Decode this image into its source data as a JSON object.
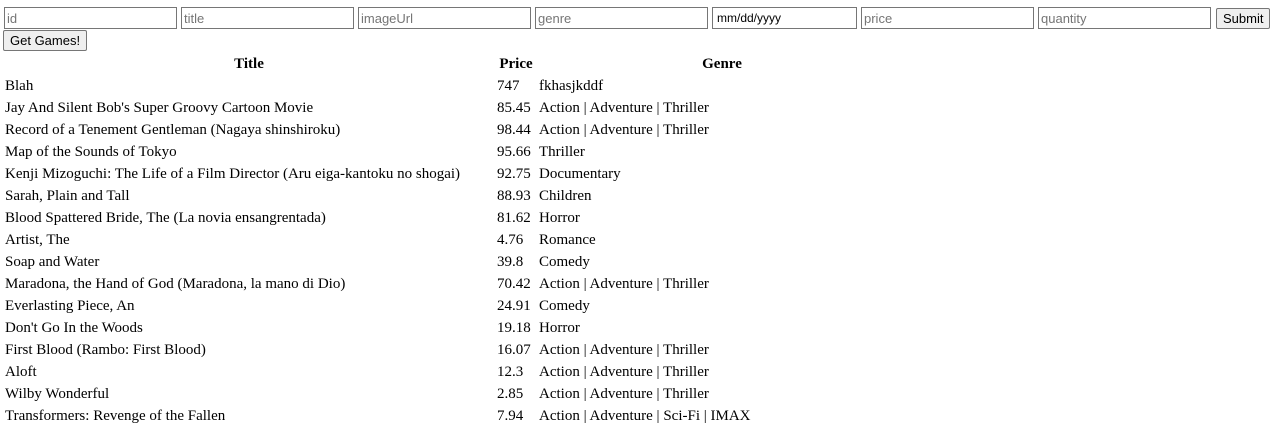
{
  "form": {
    "fields": [
      {
        "name": "id-field",
        "placeholder": "id"
      },
      {
        "name": "title-field",
        "placeholder": "title"
      },
      {
        "name": "image-url-field",
        "placeholder": "imageUrl"
      },
      {
        "name": "genre-field",
        "placeholder": "genre"
      }
    ],
    "date_placeholder": "mm/dd/yyyy",
    "fields_after_date": [
      {
        "name": "price-field",
        "placeholder": "price"
      },
      {
        "name": "quantity-field",
        "placeholder": "quantity"
      }
    ],
    "submit_label": "Submit"
  },
  "get_games_label": "Get Games!",
  "table": {
    "headers": {
      "title": "Title",
      "price": "Price",
      "genre": "Genre"
    },
    "rows": [
      {
        "title": "Blah",
        "price": "747",
        "genre": "fkhasjkddf"
      },
      {
        "title": "Jay And Silent Bob's Super Groovy Cartoon Movie",
        "price": "85.45",
        "genre": "Action | Adventure | Thriller"
      },
      {
        "title": "Record of a Tenement Gentleman (Nagaya shinshiroku)",
        "price": "98.44",
        "genre": "Action | Adventure | Thriller"
      },
      {
        "title": "Map of the Sounds of Tokyo",
        "price": "95.66",
        "genre": "Thriller"
      },
      {
        "title": "Kenji Mizoguchi: The Life of a Film Director (Aru eiga-kantoku no shogai)",
        "price": "92.75",
        "genre": "Documentary"
      },
      {
        "title": "Sarah, Plain and Tall",
        "price": "88.93",
        "genre": "Children"
      },
      {
        "title": "Blood Spattered Bride, The (La novia ensangrentada)",
        "price": "81.62",
        "genre": "Horror"
      },
      {
        "title": "Artist, The",
        "price": "4.76",
        "genre": "Romance"
      },
      {
        "title": "Soap and Water",
        "price": "39.8",
        "genre": "Comedy"
      },
      {
        "title": "Maradona, the Hand of God (Maradona, la mano di Dio)",
        "price": "70.42",
        "genre": "Action | Adventure | Thriller"
      },
      {
        "title": "Everlasting Piece, An",
        "price": "24.91",
        "genre": "Comedy"
      },
      {
        "title": "Don't Go In the Woods",
        "price": "19.18",
        "genre": "Horror"
      },
      {
        "title": "First Blood (Rambo: First Blood)",
        "price": "16.07",
        "genre": "Action | Adventure | Thriller"
      },
      {
        "title": "Aloft",
        "price": "12.3",
        "genre": "Action | Adventure | Thriller"
      },
      {
        "title": "Wilby Wonderful",
        "price": "2.85",
        "genre": "Action | Adventure | Thriller"
      },
      {
        "title": "Transformers: Revenge of the Fallen",
        "price": "7.94",
        "genre": "Action | Adventure | Sci-Fi | IMAX"
      }
    ]
  }
}
